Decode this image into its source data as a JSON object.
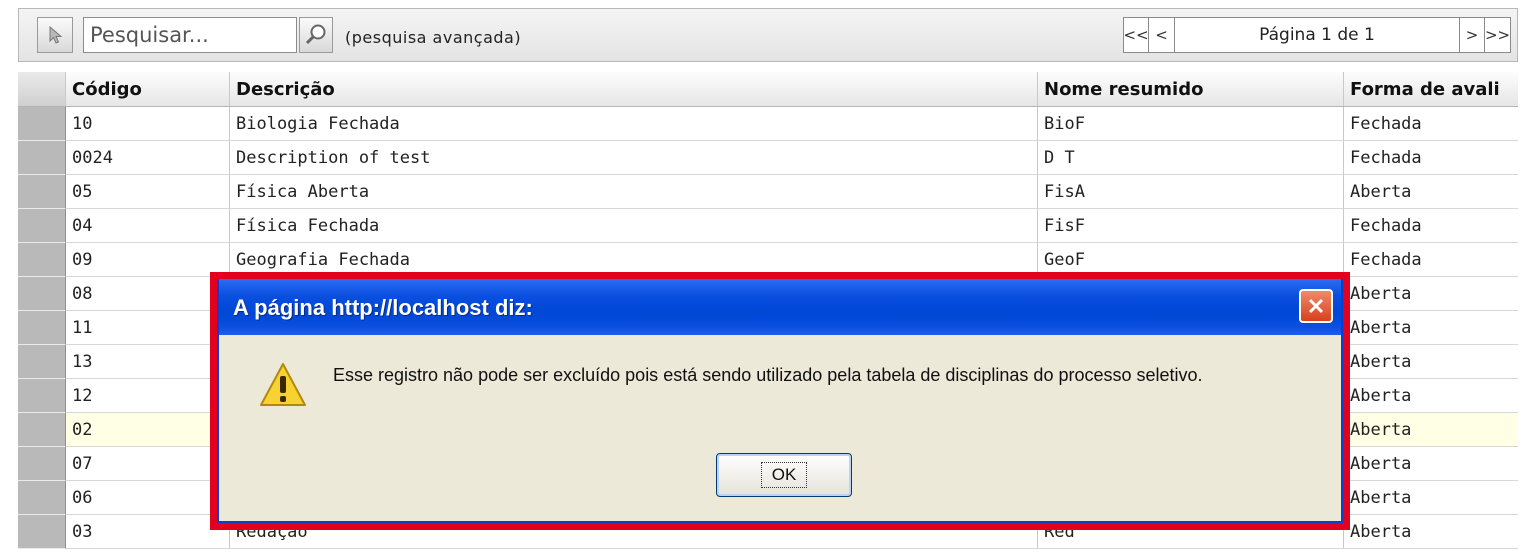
{
  "toolbar": {
    "search_placeholder": "Pesquisar...",
    "advanced_search_label": "(pesquisa avançada)",
    "pager": {
      "first_label": "<<",
      "prev_label": "<",
      "page_label": "Página 1 de 1",
      "next_label": ">",
      "last_label": ">>"
    }
  },
  "grid": {
    "columns": {
      "code": "Código",
      "description": "Descrição",
      "short_name": "Nome resumido",
      "evaluation": "Forma de avali"
    },
    "rows": [
      {
        "code": "10",
        "description": "Biologia Fechada",
        "short_name": "BioF",
        "evaluation": "Fechada"
      },
      {
        "code": "0024",
        "description": "Description of test",
        "short_name": "D T",
        "evaluation": "Fechada"
      },
      {
        "code": "05",
        "description": "Física Aberta",
        "short_name": "FisA",
        "evaluation": "Aberta"
      },
      {
        "code": "04",
        "description": "Física Fechada",
        "short_name": "FisF",
        "evaluation": "Fechada"
      },
      {
        "code": "09",
        "description": "Geografia Fechada",
        "short_name": "GeoF",
        "evaluation": "Fechada"
      },
      {
        "code": "08",
        "description": "",
        "short_name": "",
        "evaluation": "Aberta"
      },
      {
        "code": "11",
        "description": "",
        "short_name": "",
        "evaluation": "Aberta"
      },
      {
        "code": "13",
        "description": "",
        "short_name": "",
        "evaluation": "Aberta"
      },
      {
        "code": "12",
        "description": "",
        "short_name": "",
        "evaluation": "Aberta"
      },
      {
        "code": "02",
        "description": "",
        "short_name": "",
        "evaluation": "Aberta"
      },
      {
        "code": "07",
        "description": "",
        "short_name": "",
        "evaluation": "Aberta"
      },
      {
        "code": "06",
        "description": "",
        "short_name": "",
        "evaluation": "Aberta"
      },
      {
        "code": "03",
        "description": "Redação",
        "short_name": "Red",
        "evaluation": "Aberta"
      }
    ]
  },
  "dialog": {
    "title": "A página http://localhost diz:",
    "message": "Esse registro não pode ser excluído pois está sendo utilizado pela tabela de disciplinas do processo seletivo.",
    "ok_label": "OK",
    "icon": "warning-icon",
    "highlight_color": "#e2001c"
  }
}
